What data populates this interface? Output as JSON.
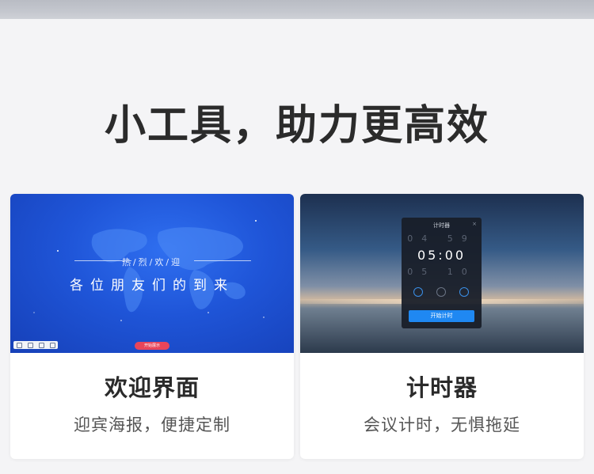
{
  "headline": "小工具，助力更高效",
  "cards": [
    {
      "title": "欢迎界面",
      "subtitle": "迎宾海报，便捷定制",
      "preview": {
        "caption": "热/烈/欢/迎",
        "main_text": "各位朋友们的到来",
        "button_label": "开始展示",
        "accent": "#1f55d8"
      }
    },
    {
      "title": "计时器",
      "subtitle": "会议计时，无惧拖延",
      "preview": {
        "panel_title": "计时器",
        "close_glyph": "×",
        "above_time": "04 59",
        "time": "05:00",
        "below_time": "05 10",
        "button_label": "开始计时",
        "accent": "#1f88f2"
      }
    }
  ]
}
